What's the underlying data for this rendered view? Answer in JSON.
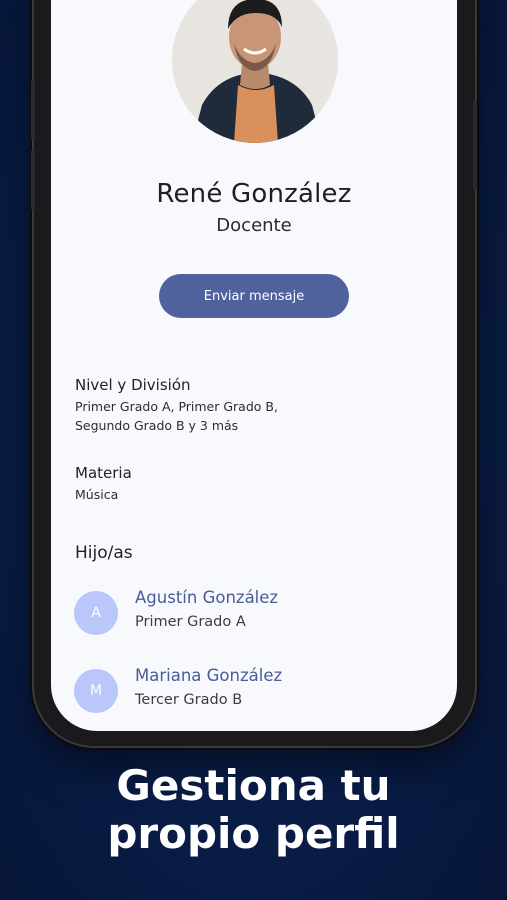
{
  "profile": {
    "name": "René González",
    "role": "Docente",
    "message_button": "Enviar mensaje"
  },
  "details": [
    {
      "label": "Nivel y División",
      "value_lines": [
        "Primer Grado A, Primer Grado B,",
        "Segundo Grado B y 3 más"
      ]
    },
    {
      "label": "Materia",
      "value_lines": [
        "Música"
      ]
    }
  ],
  "children": {
    "title": "Hijo/as",
    "items": [
      {
        "initial": "A",
        "name": "Agustín González",
        "grade": "Primer Grado A"
      },
      {
        "initial": "M",
        "name": "Mariana González",
        "grade": "Tercer Grado B"
      }
    ]
  },
  "headline": {
    "line1": "Gestiona tu",
    "line2": "propio perfil"
  },
  "colors": {
    "background": "#0a1f4c",
    "button": "#4f629e",
    "child_name": "#485c99",
    "child_avatar": "#b9c7fb"
  }
}
